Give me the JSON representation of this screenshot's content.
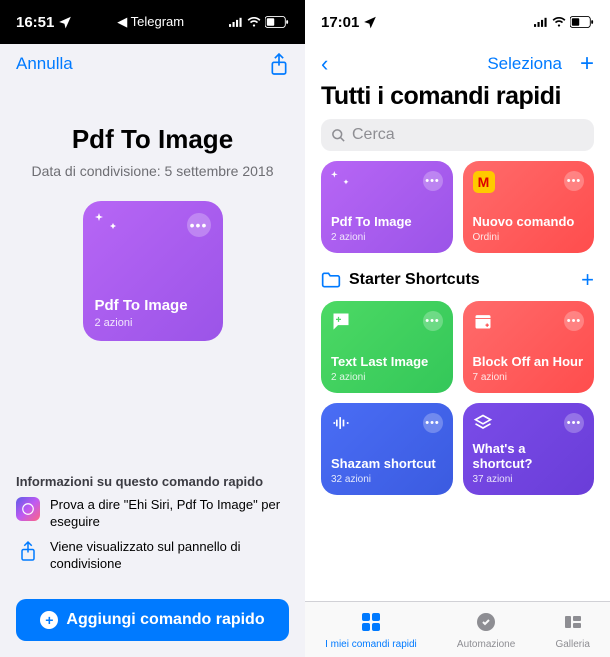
{
  "left": {
    "status": {
      "time": "16:51",
      "back_app": "Telegram"
    },
    "nav": {
      "cancel": "Annulla"
    },
    "title": "Pdf To Image",
    "share_date": "Data di condivisione: 5 settembre 2018",
    "tile": {
      "name": "Pdf To Image",
      "sub": "2 azioni"
    },
    "info": {
      "heading": "Informazioni su questo comando rapido",
      "siri": "Prova a dire \"Ehi Siri, Pdf To Image\" per eseguire",
      "share": "Viene visualizzato sul pannello di condivisione"
    },
    "add_button": "Aggiungi comando rapido"
  },
  "right": {
    "status": {
      "time": "17:01"
    },
    "nav": {
      "select": "Seleziona"
    },
    "title": "Tutti i comandi rapidi",
    "search_placeholder": "Cerca",
    "my_tiles": [
      {
        "name": "Pdf To Image",
        "sub": "2 azioni",
        "icon": "magic",
        "color": "purple"
      },
      {
        "name": "Nuovo comando",
        "sub": "Ordini",
        "icon": "mcdonalds",
        "color": "red"
      }
    ],
    "section_title": "Starter Shortcuts",
    "starter_tiles": [
      {
        "name": "Text Last Image",
        "sub": "2 azioni",
        "icon": "chat-plus",
        "color": "green"
      },
      {
        "name": "Block Off an Hour",
        "sub": "7 azioni",
        "icon": "calendar-plus",
        "color": "red"
      },
      {
        "name": "Shazam shortcut",
        "sub": "32 azioni",
        "icon": "shazam",
        "color": "blue"
      },
      {
        "name": "What's a shortcut?",
        "sub": "37 azioni",
        "icon": "layers",
        "color": "violet"
      }
    ],
    "tabs": [
      {
        "label": "I miei comandi rapidi",
        "active": true
      },
      {
        "label": "Automazione",
        "active": false
      },
      {
        "label": "Galleria",
        "active": false
      }
    ]
  }
}
